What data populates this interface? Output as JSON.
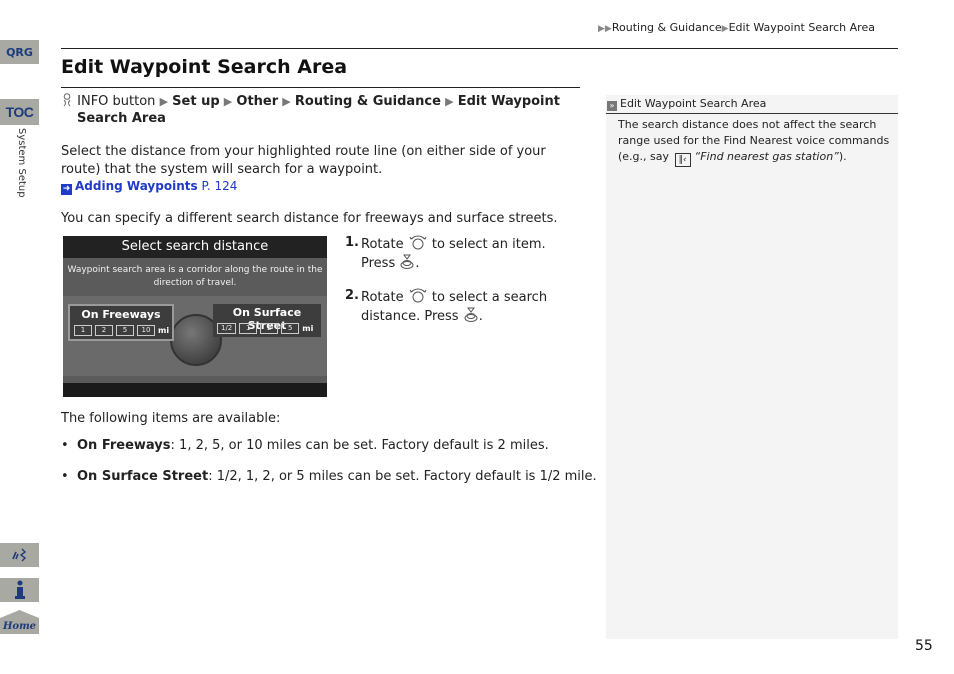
{
  "side_tabs": {
    "qrg": "QRG",
    "toc": "TOC",
    "section_label": "System Setup",
    "voice_icon": "voice-command-icon",
    "info_icon": "info-icon",
    "home_label": "Home"
  },
  "breadcrumb": {
    "prefix": "▶▶",
    "items": [
      "Routing & Guidance",
      "Edit Waypoint Search Area"
    ]
  },
  "page_title": "Edit Waypoint Search Area",
  "menu_path": {
    "icon": "info-button-icon",
    "start": "INFO button",
    "steps": [
      "Set up",
      "Other",
      "Routing & Guidance",
      "Edit Waypoint"
    ],
    "continuation": "Search Area"
  },
  "intro": "Select the distance from your highlighted route line (on either side of your route) that the system will search for a waypoint.",
  "cross_ref": {
    "label": "Adding Waypoints",
    "page": "P. 124"
  },
  "specify_text": "You can specify a different search distance for freeways and surface streets.",
  "screen": {
    "title": "Select search distance",
    "description": "Waypoint search area is a corridor along the route in the direction of travel.",
    "freeways": {
      "label": "On Freeways",
      "options": [
        "1",
        "2",
        "5",
        "10"
      ],
      "unit": "mi"
    },
    "surface": {
      "label": "On Surface Street",
      "options": [
        "1/2",
        "1",
        "2",
        "5"
      ],
      "unit": "mi"
    }
  },
  "steps": [
    {
      "num": "1.",
      "pre": "Rotate",
      "mid": "to select an item.",
      "press": "Press",
      "end": "."
    },
    {
      "num": "2.",
      "pre": "Rotate",
      "mid": "to select a search",
      "press": "distance. Press",
      "end": "."
    }
  ],
  "available_text": "The following items are available:",
  "items": [
    {
      "term": "On Freeways",
      "desc": ": 1, 2, 5, or 10 miles can be set. Factory default is 2 miles."
    },
    {
      "term": "On Surface Street",
      "desc": ": 1/2, 1, 2, or 5 miles can be set. Factory default is 1/2 mile."
    }
  ],
  "note": {
    "title": "Edit Waypoint Search Area",
    "body_1": "The search distance does not affect the search range used for the Find Nearest voice commands (e.g., say",
    "quote": "“Find nearest gas station”",
    "body_2": ")."
  },
  "page_number": "55",
  "colors": {
    "link_blue": "#1f3bc7",
    "tab_gray": "#a9a9a4",
    "tab_text": "#1d3a7a",
    "note_bg": "#f4f4f4"
  }
}
